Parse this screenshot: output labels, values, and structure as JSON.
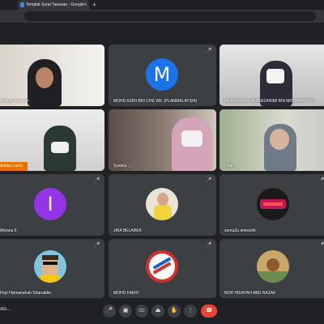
{
  "browser": {
    "tab_title": "Templat Surat Tawaran - Google...",
    "tab_close": "×",
    "new_tab": "+"
  },
  "tiles": [
    {
      "name": "khairun nasurah"
    },
    {
      "name": "MOHD AZIRI BIN CHE WIL (PLANMALAYSIA)",
      "avatar_letter": "M",
      "avatar_color": "#1a73e8"
    },
    {
      "name": "MUHAMMAD HAZARZARIMI BIN MOHAMAD FR..."
    },
    {
      "name": "Anida Losiro"
    },
    {
      "name": "Syalina ..."
    },
    {
      "name": "Chai ..."
    },
    {
      "name": "Aliyana II",
      "avatar_letter": "I",
      "avatar_color": "#9334e6"
    },
    {
      "name": "JIRA BELAREK"
    },
    {
      "name": "sumuZu smoooth"
    },
    {
      "name": "Fiqri Hylmanshah Sharuddin"
    },
    {
      "name": "MOHD FAKRI"
    },
    {
      "name": "NOR HIDAYAH ABD RAZAK"
    }
  ],
  "controls": {
    "meeting_label": "sto...",
    "mic": "🎤",
    "camera": "▣",
    "captions": "CC",
    "present": "⏏",
    "raise_hand": "✋",
    "more": "⋮",
    "end": "☎"
  },
  "icons": {
    "mic_off": "🎤"
  }
}
